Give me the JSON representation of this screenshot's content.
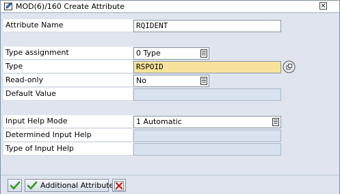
{
  "dialog": {
    "title": "MOD(6)/160 Create Attribute",
    "close_label": "×"
  },
  "fields": {
    "attribute_name": {
      "label": "Attribute Name",
      "value": "RQIDENT"
    },
    "type_assignment": {
      "label": "Type assignment",
      "value": "0 Type"
    },
    "type": {
      "label": "Type",
      "value": "RSPOID"
    },
    "read_only": {
      "label": "Read-only",
      "value": "No"
    },
    "default_value": {
      "label": "Default Value",
      "value": ""
    },
    "input_help_mode": {
      "label": "Input Help Mode",
      "value": "1 Automatic"
    },
    "determined_input_help": {
      "label": "Determined Input Help",
      "value": ""
    },
    "type_of_input_help": {
      "label": "Type of Input Help",
      "value": ""
    }
  },
  "footer": {
    "additional_attribute_label": "Additional Attribute"
  },
  "colors": {
    "highlight_field": "#f7e39b",
    "readonly_field": "#d9e3f0",
    "panel_bg": "#dfe4ee",
    "ok_green": "#2f9a1f",
    "cancel_red": "#c8261c"
  },
  "icons": [
    "window-icon",
    "close-icon",
    "dropdown-icon",
    "value-help-icon",
    "check-icon",
    "cancel-icon"
  ]
}
